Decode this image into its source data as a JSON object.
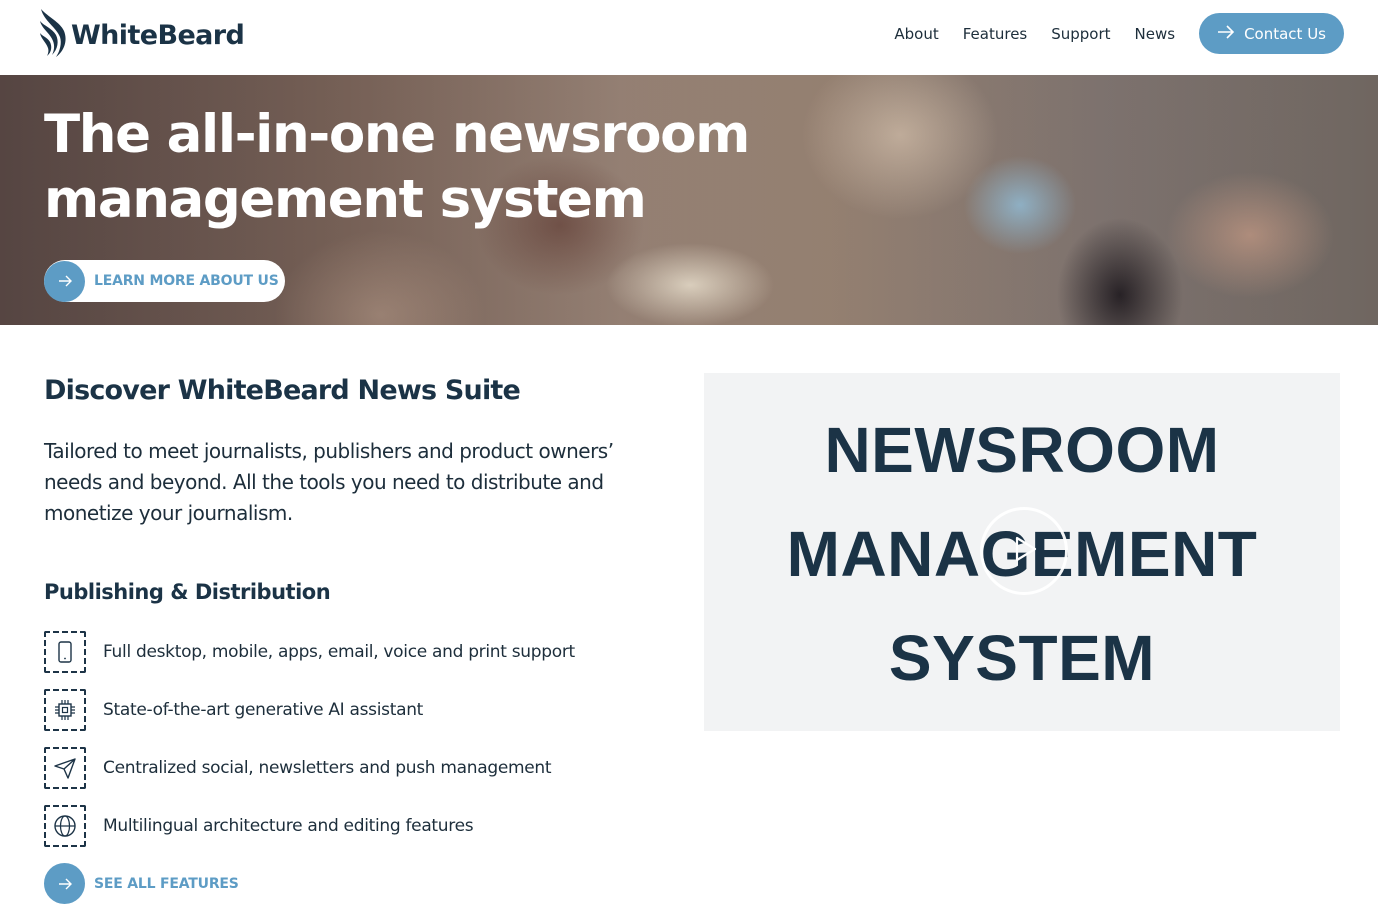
{
  "brand": {
    "name": "WhiteBeard",
    "logo_icon": "whitebeard-wing-icon",
    "accent": "#5d9cc5",
    "dark": "#1b3346"
  },
  "nav": {
    "links": [
      "About",
      "Features",
      "Support",
      "News"
    ],
    "contact_label": "Contact Us"
  },
  "hero": {
    "title_line1": "The all-in-one newsroom",
    "title_line2": "management system",
    "cta_label": "LEARN MORE ABOUT US"
  },
  "discover": {
    "title": "Discover WhiteBeard News Suite",
    "description": "Tailored to meet journalists, publishers and product owners’ needs and beyond. All the tools you need to distribute and monetize your journalism."
  },
  "publishing": {
    "title": "Publishing & Distribution",
    "features": [
      {
        "icon": "mobile-icon",
        "text": "Full desktop, mobile, apps, email, voice and print support"
      },
      {
        "icon": "chip-icon",
        "text": "State-of-the-art generative AI assistant"
      },
      {
        "icon": "send-icon",
        "text": "Centralized social, newsletters and push management"
      },
      {
        "icon": "globe-icon",
        "text": "Multilingual architecture and editing features"
      }
    ],
    "cta_label": "SEE ALL FEATURES"
  },
  "video": {
    "line1": "NEWSROOM",
    "line2": "MANAGEMENT",
    "line3": "SYSTEM",
    "play_icon": "play-icon"
  }
}
